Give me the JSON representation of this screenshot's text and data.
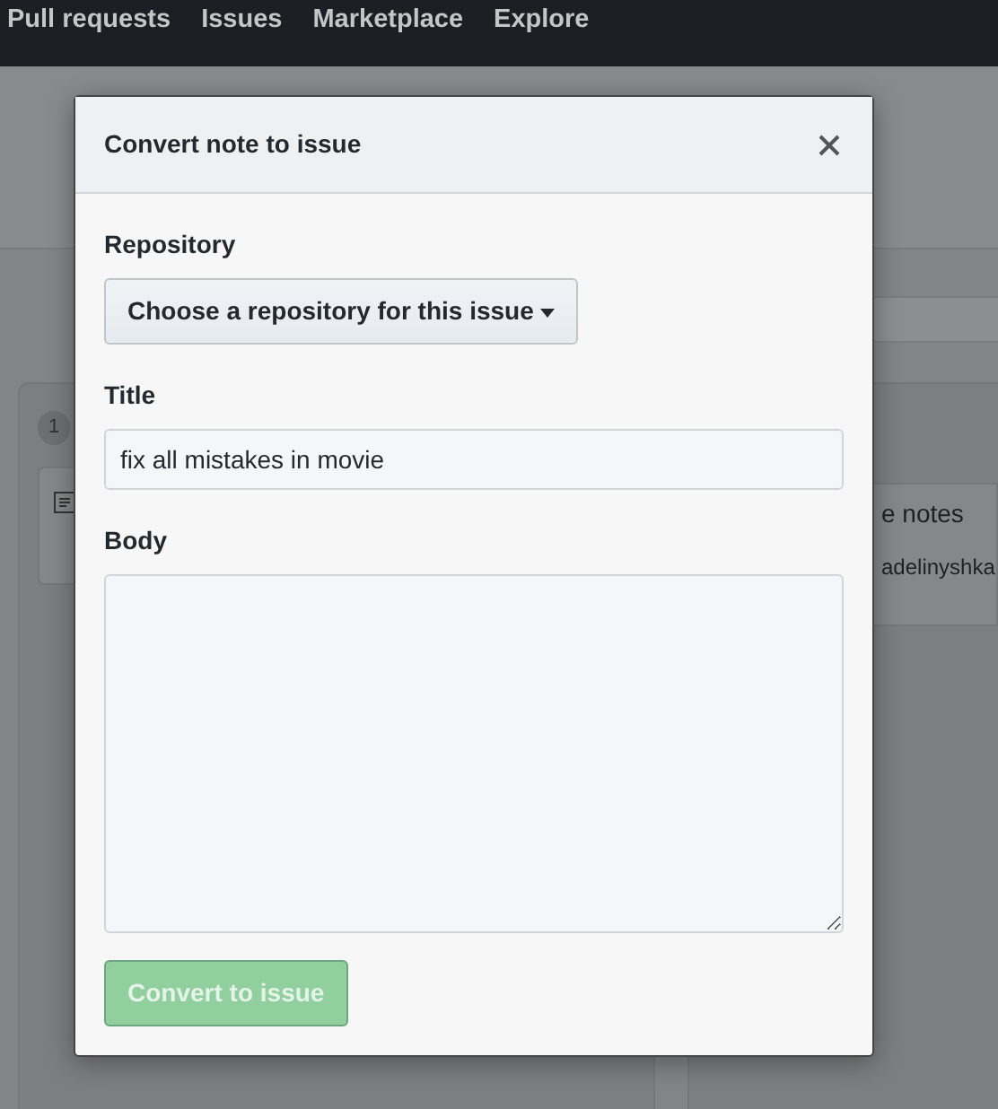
{
  "nav": {
    "links": [
      "Pull requests",
      "Issues",
      "Marketplace",
      "Explore"
    ]
  },
  "board": {
    "column_1": {
      "count": "1"
    },
    "column_2": {
      "card_text": "e notes",
      "card_author": "adelinyshka"
    }
  },
  "modal": {
    "title": "Convert note to issue",
    "repository": {
      "label": "Repository",
      "button": "Choose a repository for this issue"
    },
    "issue_title": {
      "label": "Title",
      "value": "fix all mistakes in movie"
    },
    "body": {
      "label": "Body"
    },
    "submit": {
      "label": "Convert to issue",
      "disabled": true
    }
  }
}
